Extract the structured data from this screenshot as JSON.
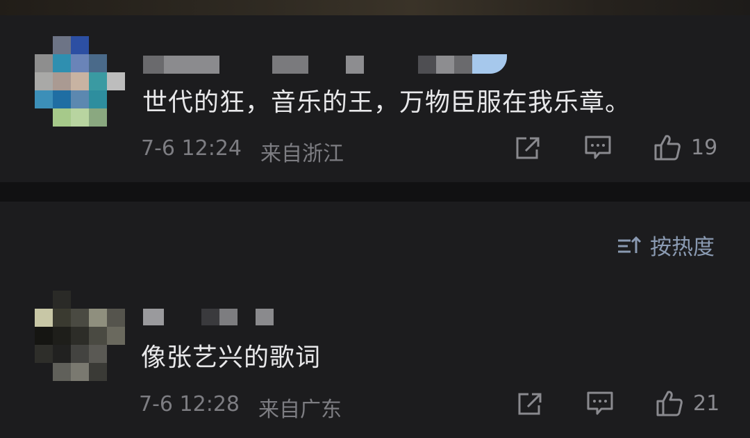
{
  "comments": [
    {
      "text": "世代的狂，音乐的王，万物臣服在我乐章。",
      "timestamp": "7-6 12:24",
      "location": "来自浙江",
      "like_count": "19"
    },
    {
      "text": "像张艺兴的歌词",
      "timestamp": "7-6 12:28",
      "location": "来自广东",
      "like_count": "21"
    }
  ],
  "sort": {
    "label": "按热度"
  },
  "icons": {
    "share": "share-icon",
    "reply": "comment-icon",
    "like": "thumbs-up-icon",
    "sort": "sort-icon"
  },
  "colors": {
    "background": "#1c1c1e",
    "separator": "#111112",
    "comment_text": "#e8e8ea",
    "meta_text": "#7d7d82",
    "sort_text": "#8a9ab2"
  }
}
